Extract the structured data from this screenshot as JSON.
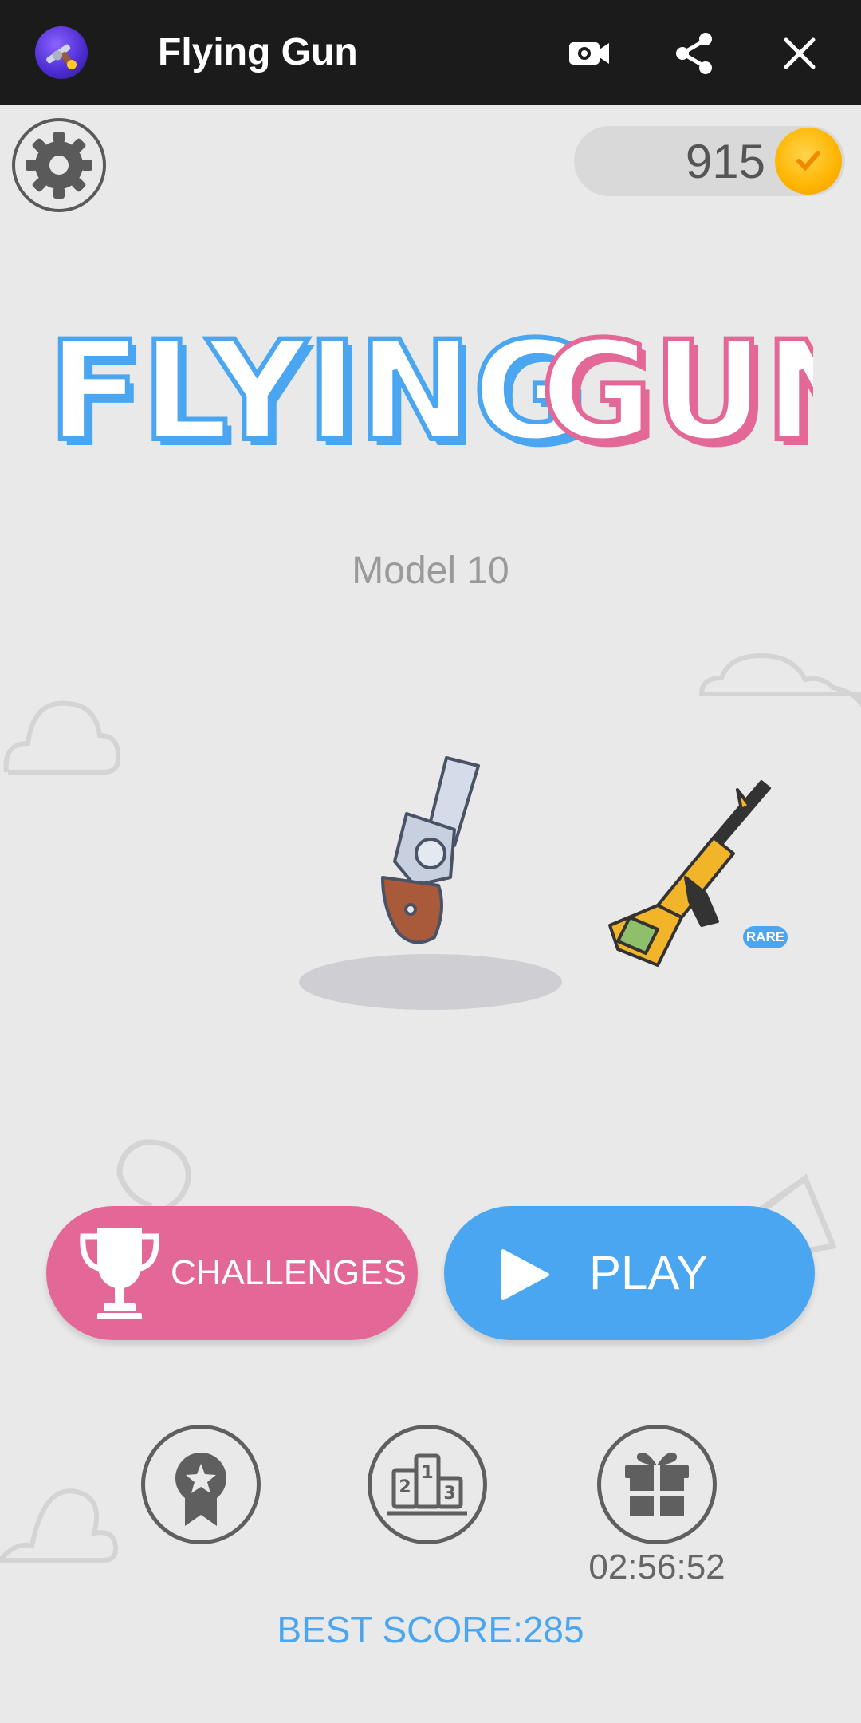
{
  "topbar": {
    "title": "Flying Gun",
    "app_icon": "app-logo-icon",
    "icons": [
      "record-video-icon",
      "share-icon",
      "close-icon"
    ],
    "background": "#1b1b1b"
  },
  "hud": {
    "settings_icon": "gear-icon",
    "coins": "915",
    "coin_icon": "coin-icon"
  },
  "logo": {
    "word1": "FLYING",
    "word2": "GUN",
    "word1_color": "#4aa6f0",
    "word2_color": "#e36898"
  },
  "model_label": "Model 10",
  "weapons": {
    "current": "revolver-icon",
    "next": "rifle-icon",
    "next_badge": "RARE"
  },
  "buttons": {
    "challenges_label": "CHALLENGES",
    "challenges_color": "#e36898",
    "play_label": "PLAY",
    "play_color": "#4aa6f0"
  },
  "bottom": {
    "icons": [
      "achievement-badge-icon",
      "leaderboard-podium-icon",
      "gift-icon"
    ],
    "gift_timer": "02:56:52",
    "best_score": "BEST SCORE:285"
  }
}
